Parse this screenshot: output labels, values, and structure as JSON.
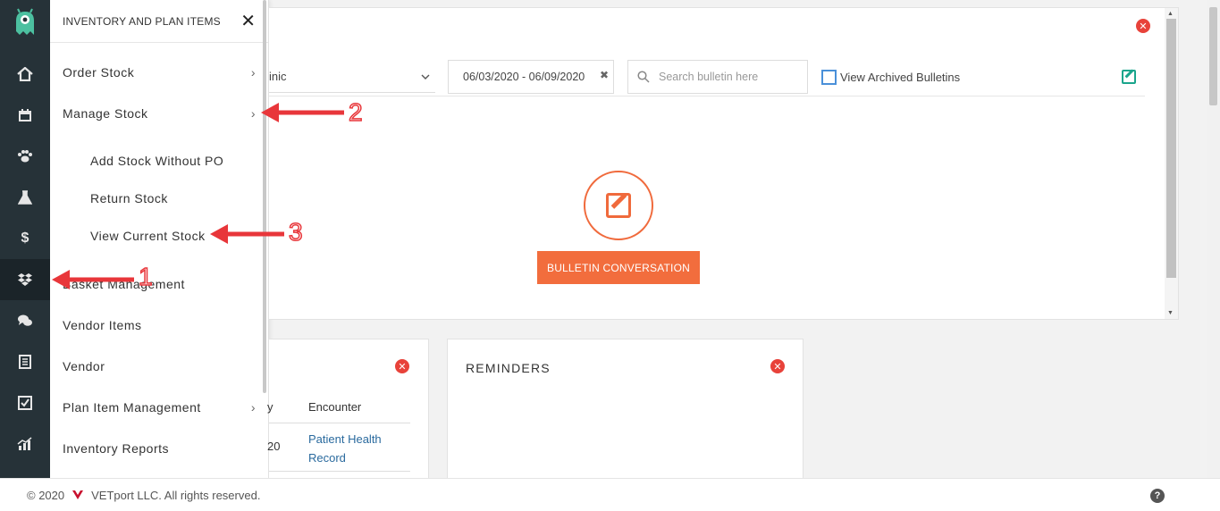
{
  "flyout": {
    "title": "INVENTORY AND PLAN ITEMS",
    "close_glyph": "✕",
    "items": [
      {
        "label": "Order Stock",
        "chevron": "›"
      },
      {
        "label": "Manage Stock",
        "chevron": "›"
      },
      {
        "label": "Add Stock Without PO"
      },
      {
        "label": "Return Stock"
      },
      {
        "label": "View Current Stock"
      },
      {
        "label": "Basket Management"
      },
      {
        "label": "Vendor Items"
      },
      {
        "label": "Vendor"
      },
      {
        "label": "Plan Item Management",
        "chevron": "›"
      },
      {
        "label": "Inventory Reports"
      }
    ]
  },
  "rail": {
    "icons": [
      "home-icon",
      "calendar-icon",
      "paw-icon",
      "flask-icon",
      "dollar-icon",
      "boxes-icon",
      "chat-icon",
      "document-icon",
      "checkbox-icon",
      "chart-icon",
      "gear-icon"
    ],
    "dollar_glyph": "$"
  },
  "bulletin": {
    "clinic_value": "inic",
    "date_range": "06/03/2020 - 06/09/2020",
    "clear_glyph": "✖",
    "search_placeholder": "Search bulletin here",
    "archived_label": "View Archived Bulletins",
    "button_label": "BULLETIN CONVERSATION",
    "close_glyph": "✕"
  },
  "encounter_card": {
    "col_left_fragment": "y",
    "col_header": "Encounter",
    "row_fragment": "20",
    "row_link": "Patient Health Record"
  },
  "reminders": {
    "title": "REMINDERS"
  },
  "footer": {
    "copyright": "© 2020",
    "company": "VETport LLC. All rights reserved.",
    "help_glyph": "?"
  },
  "annotations": {
    "labels": [
      "1",
      "2",
      "3"
    ]
  },
  "colors": {
    "rail_bg": "#263238",
    "accent_orange": "#f26d3d",
    "close_red": "#e8423a",
    "arrow_red": "#e8363a",
    "link_blue": "#2a6a9e"
  }
}
